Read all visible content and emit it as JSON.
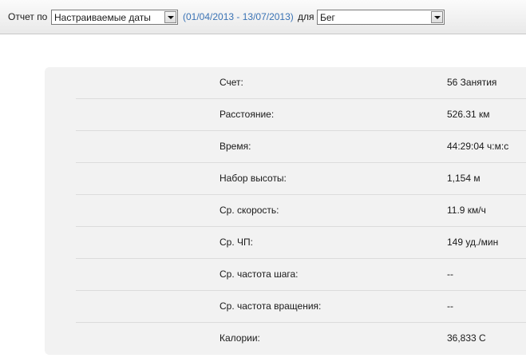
{
  "toolbar": {
    "report_label": "Отчет по",
    "period_select": {
      "selected": "Настраиваемые даты"
    },
    "date_range": "(01/04/2013 - 13/07/2013)",
    "for_label": "для",
    "activity_select": {
      "selected": "Бег"
    }
  },
  "stats": [
    {
      "label": "Счет:",
      "value": "56 Занятия"
    },
    {
      "label": "Расстояние:",
      "value": "526.31 км"
    },
    {
      "label": "Время:",
      "value": "44:29:04 ч:м:с"
    },
    {
      "label": "Набор высоты:",
      "value": "1,154 м"
    },
    {
      "label": "Ср. скорость:",
      "value": "11.9 км/ч"
    },
    {
      "label": "Ср. ЧП:",
      "value": "149 уд./мин"
    },
    {
      "label": "Ср. частота шага:",
      "value": "--"
    },
    {
      "label": "Ср. частота вращения:",
      "value": "--"
    },
    {
      "label": "Калории:",
      "value": "36,833 С"
    }
  ],
  "icons": {
    "dropdown": "chevron-down-icon"
  }
}
